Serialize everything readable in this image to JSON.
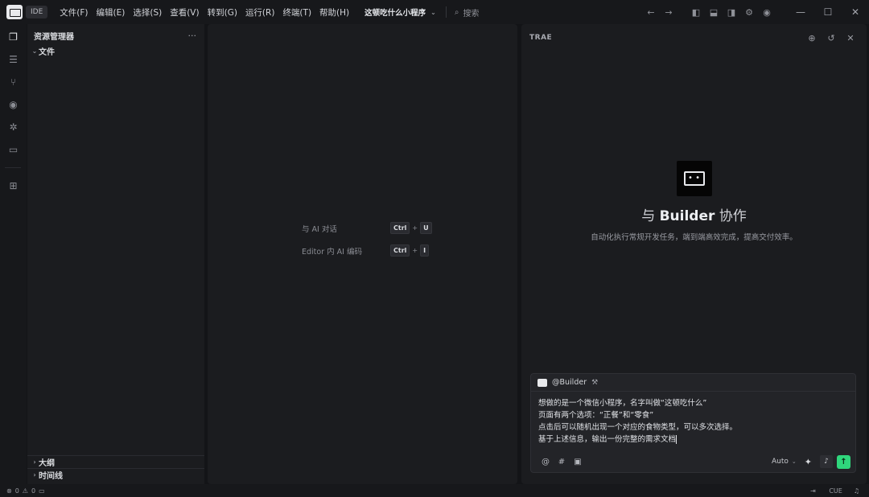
{
  "titlebar": {
    "ide_label": "IDE",
    "menu": [
      "文件(F)",
      "编辑(E)",
      "选择(S)",
      "查看(V)",
      "转到(G)",
      "运行(R)",
      "终端(T)",
      "帮助(H)"
    ],
    "project_name": "这顿吃什么小程序",
    "search_placeholder": "搜索"
  },
  "activity_icons": [
    "files-icon",
    "search-list-icon",
    "source-control-icon",
    "eye-icon",
    "bug-icon",
    "remote-monitor-icon",
    "extensions-icon"
  ],
  "explorer": {
    "title": "资源管理器",
    "more": "···",
    "root_folder": "文件",
    "bottom_sections": [
      "大纲",
      "时间线"
    ]
  },
  "editor": {
    "shortcuts": [
      {
        "label": "与 AI 对话",
        "keys": [
          "Ctrl",
          "U"
        ]
      },
      {
        "label": "Editor 内 AI 编码",
        "keys": [
          "Ctrl",
          "I"
        ]
      }
    ]
  },
  "chat": {
    "title": "TRAE",
    "hero_prefix": "与",
    "hero_name": "Builder",
    "hero_suffix": "协作",
    "hero_subtitle": "自动化执行常规开发任务，端到端高效完成，提高交付效率。",
    "agent": "@Builder",
    "message_lines": [
      "想做的是一个微信小程序，名字叫做“这顿吃什么”",
      "页面有两个选项：“正餐”和“零食”",
      "点击后可以随机出现一个对应的食物类型，可以多次选择。",
      "基于上述信息，输出一份完整的需求文档"
    ],
    "mode": "Auto"
  },
  "statusbar": {
    "errors": "0",
    "warnings": "0",
    "cue_label": "CUE"
  },
  "colors": {
    "accent_send": "#2fd67c",
    "background": "#131417",
    "panel": "#1b1c1f"
  }
}
